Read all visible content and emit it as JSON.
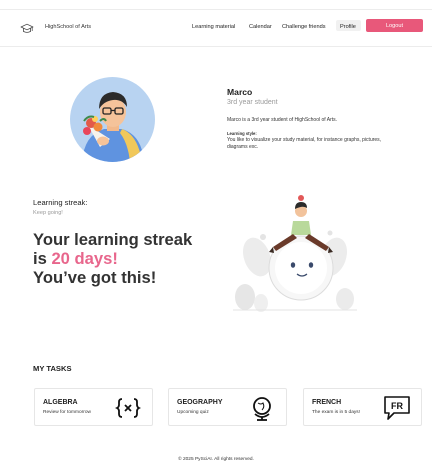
{
  "header": {
    "brand": "HighSchool of Arts",
    "nav": [
      {
        "label": "Learning material"
      },
      {
        "label": "Calendar"
      },
      {
        "label": "Challenge friends"
      },
      {
        "label": "Profile"
      }
    ],
    "logout_label": "Logout",
    "icon": "graduation-cap-icon"
  },
  "profile": {
    "name": "Marco",
    "year": "3rd year student",
    "description": "Marco is a 3rd year student of HighSchool of Arts.",
    "style_label": "Learning style:",
    "style_text": "You like to visualize your study material, for instance graphs, pictures, diagrams exc."
  },
  "streak": {
    "label": "Learning streak:",
    "subtitle": "Keep going!",
    "line1": "Your learning streak",
    "is": "is ",
    "days": "20 days!",
    "line3": "You’ve got this!"
  },
  "tasks": {
    "title": "MY TASKS",
    "cards": [
      {
        "name": "ALGEBRA",
        "sub": "Review for tommorrow",
        "icon": "function-braces-icon"
      },
      {
        "name": "GEOGRAPHY",
        "sub": "Upcoming quiz",
        "icon": "globe-icon"
      },
      {
        "name": "FRENCH",
        "sub": "The exam is in 5 days!",
        "icon": "speech-bubble-fr-icon",
        "icon_text": "FR"
      }
    ]
  },
  "footer": "© 2025 PySciAI. All rights reserved.",
  "colors": {
    "accent": "#e8587a",
    "streak": "#e8668c",
    "avatar_bg": "#b8d3f1"
  }
}
